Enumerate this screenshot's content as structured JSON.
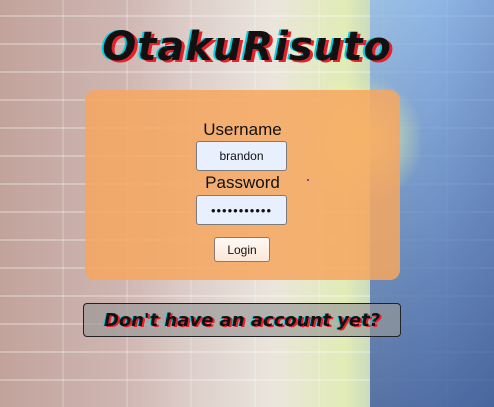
{
  "app": {
    "title": "OtakuRisuto"
  },
  "login_form": {
    "username_label": "Username",
    "username_value": "brandon",
    "password_label": "Password",
    "password_value": "•••••••••••",
    "login_button": "Login"
  },
  "signup": {
    "link_text": "Don't have an account yet?"
  },
  "colors": {
    "card": "#f6a660",
    "title_shadow_red": "#e3212b",
    "title_shadow_cyan": "#00d0e0",
    "input_bg": "#e8f0fd"
  }
}
